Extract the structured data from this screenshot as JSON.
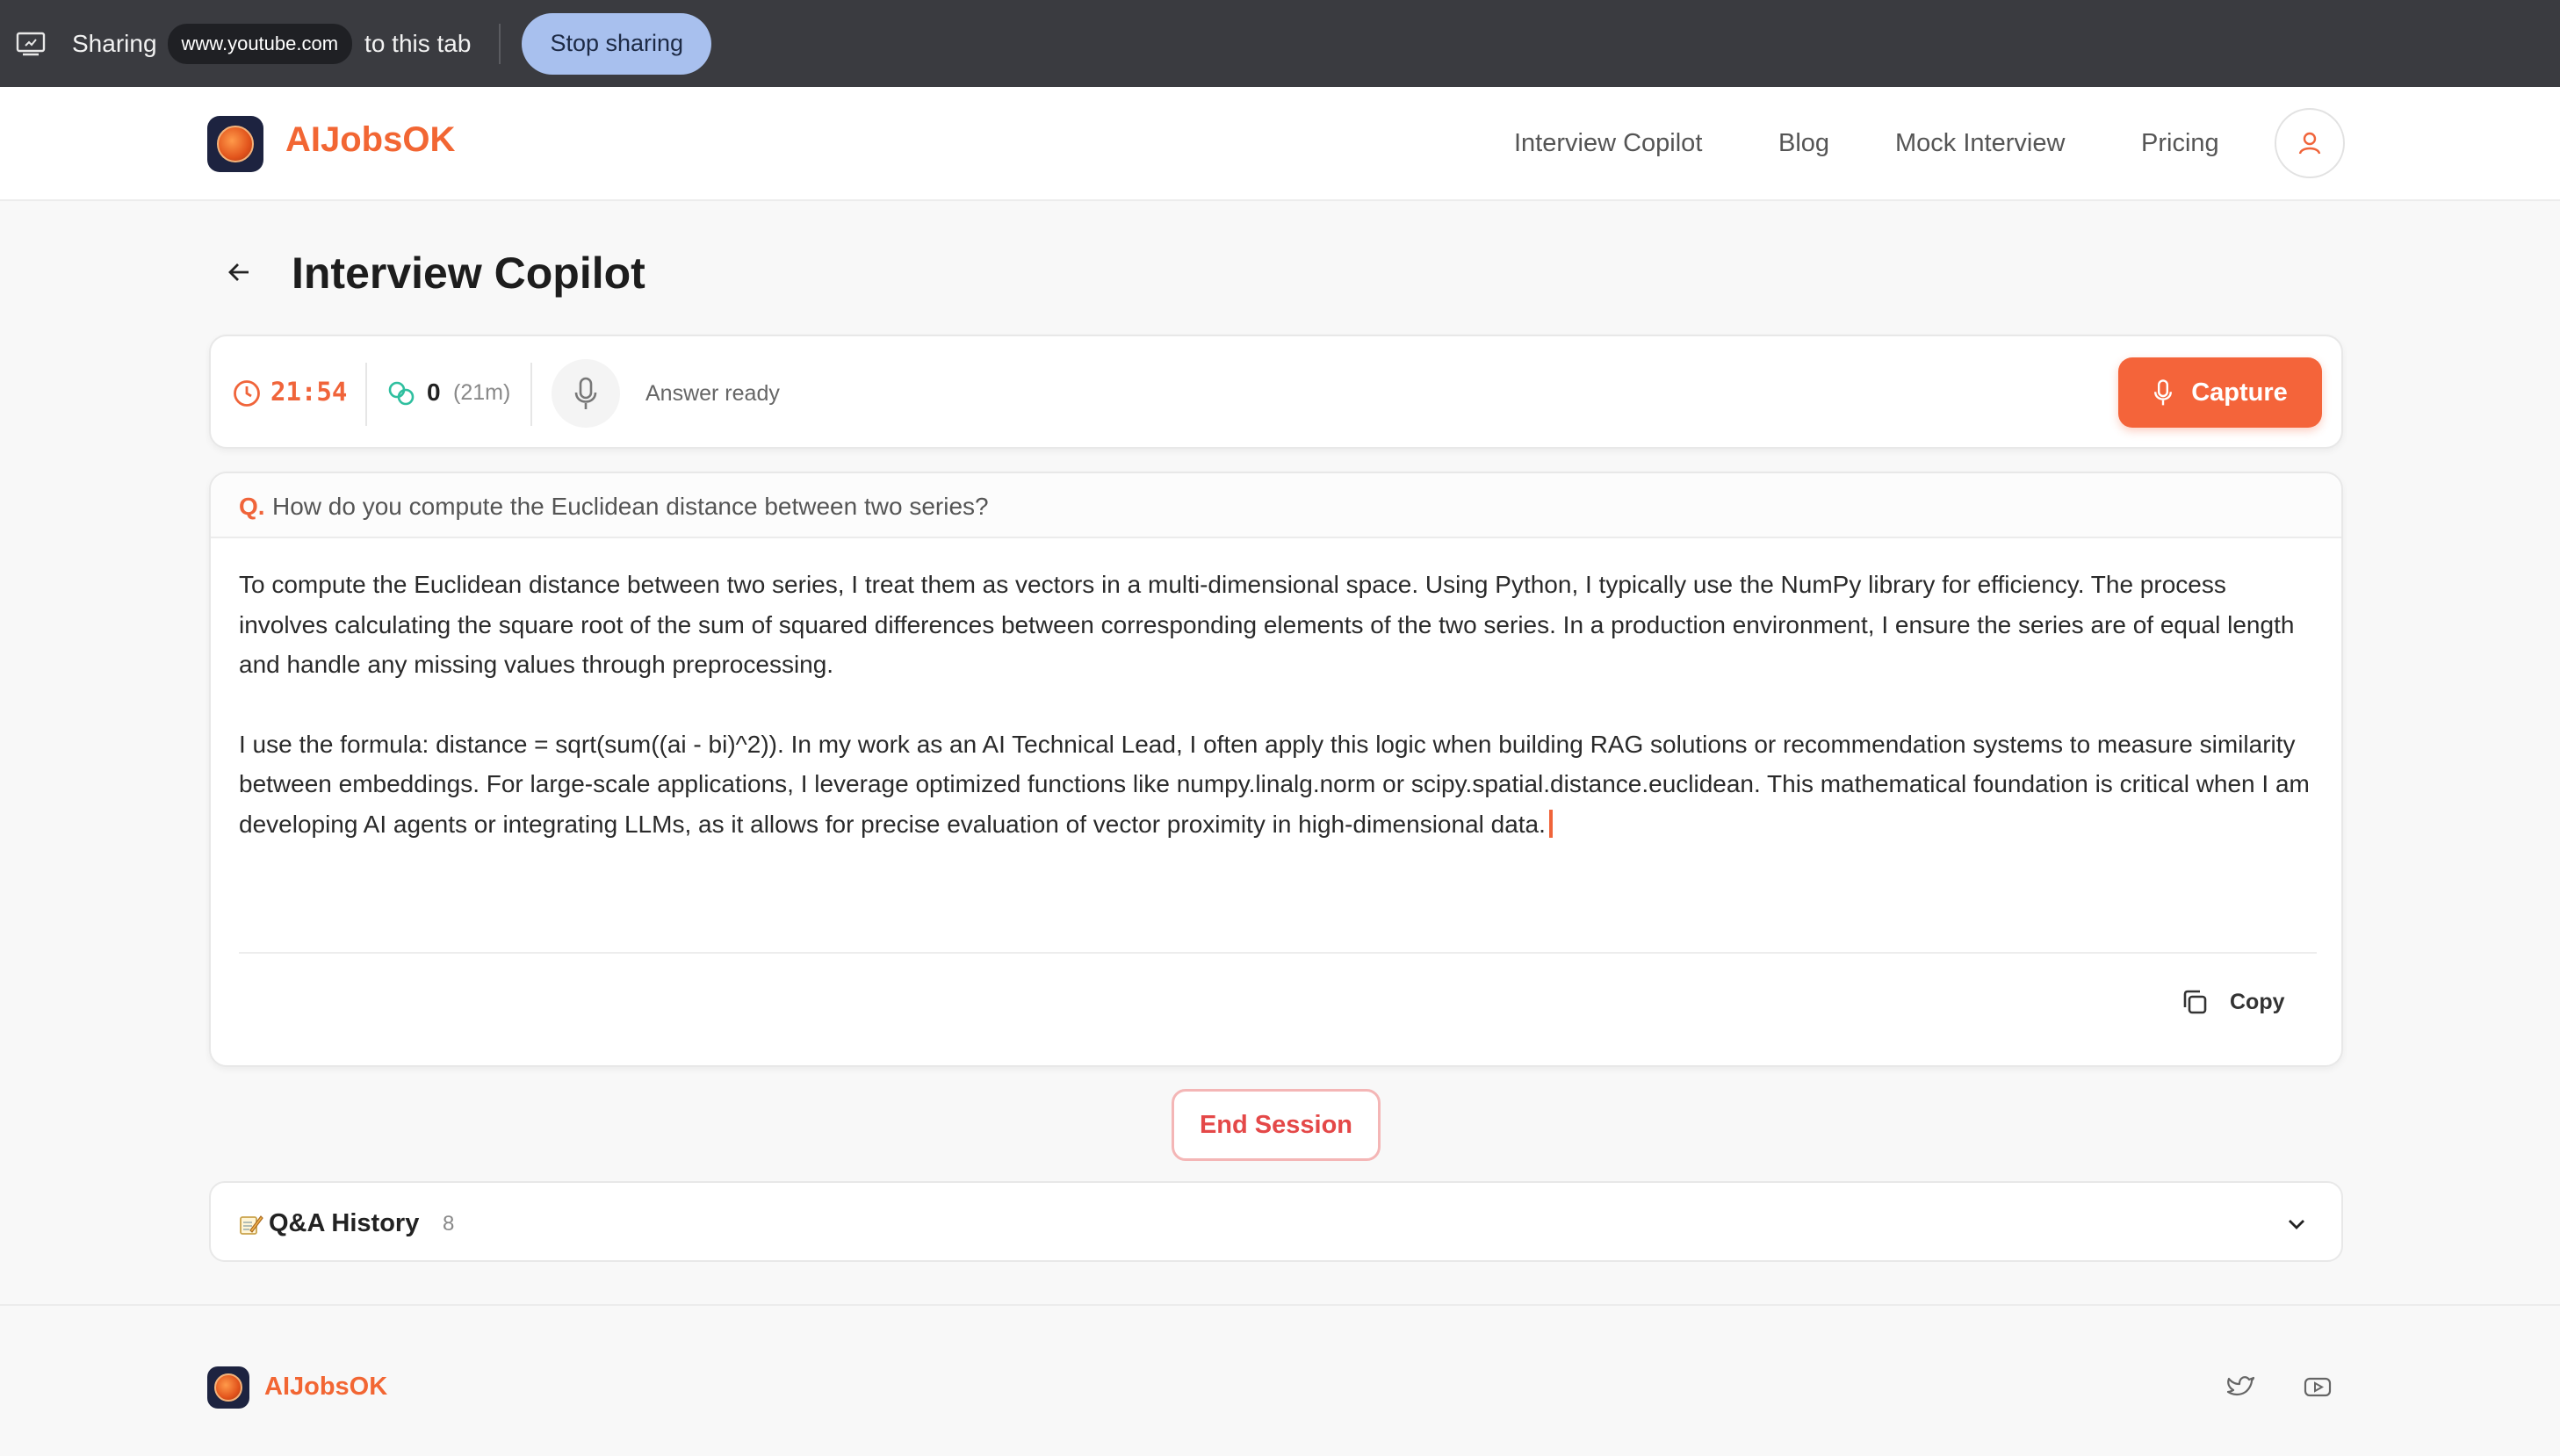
{
  "share_bar": {
    "sharing_label": "Sharing",
    "domain": "www.youtube.com",
    "suffix": "to this tab",
    "stop_label": "Stop sharing"
  },
  "nav": {
    "brand": "AIJobsOK",
    "links": [
      "Interview Copilot",
      "Blog",
      "Mock Interview",
      "Pricing"
    ]
  },
  "page": {
    "title": "Interview Copilot"
  },
  "status": {
    "timer": "21:54",
    "count": "0",
    "count_sub": "(21m)",
    "answer_state": "Answer ready",
    "capture_label": "Capture"
  },
  "qa": {
    "q_prefix": "Q.",
    "question": "How do you compute the Euclidean distance between two series?",
    "paragraphs": [
      "To compute the Euclidean distance between two series, I treat them as vectors in a multi-dimensional space. Using Python, I typically use the NumPy library for efficiency. The process involves calculating the square root of the sum of squared differences between corresponding elements of the two series. In a production environment, I ensure the series are of equal length and handle any missing values through preprocessing.",
      "I use the formula: distance = sqrt(sum((ai - bi)^2)). In my work as an AI Technical Lead, I often apply this logic when building RAG solutions or recommendation systems to measure similarity between embeddings. For large-scale applications, I leverage optimized functions like numpy.linalg.norm or scipy.spatial.distance.euclidean. This mathematical foundation is critical when I am developing AI agents or integrating LLMs, as it allows for precise evaluation of vector proximity in high-dimensional data."
    ],
    "copy_label": "Copy"
  },
  "end_session_label": "End Session",
  "history": {
    "title": "Q&A History",
    "count": "8"
  },
  "footer": {
    "brand": "AIJobsOK"
  },
  "colors": {
    "accent": "#f4643a",
    "danger": "#e44848",
    "share_bar_bg": "#3a3b40"
  }
}
